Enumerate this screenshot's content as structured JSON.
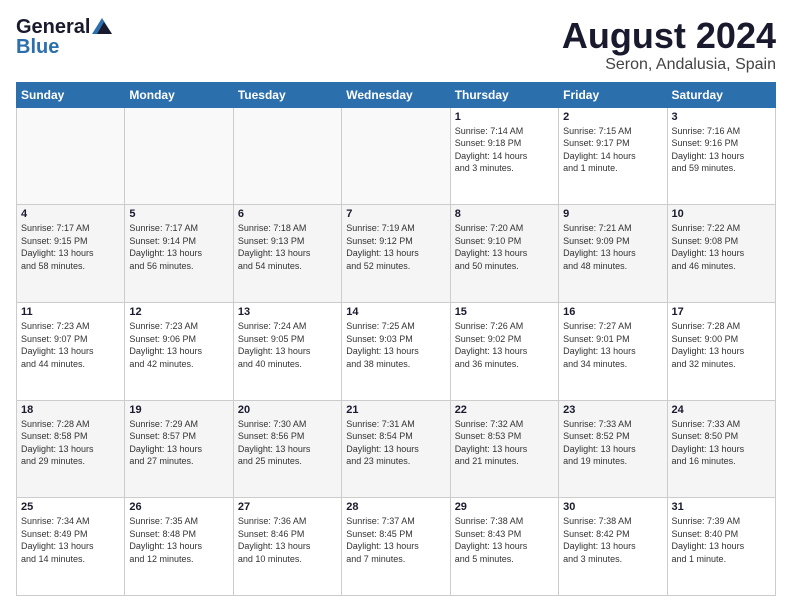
{
  "header": {
    "logo_general": "General",
    "logo_blue": "Blue",
    "title": "August 2024",
    "subtitle": "Seron, Andalusia, Spain"
  },
  "days_of_week": [
    "Sunday",
    "Monday",
    "Tuesday",
    "Wednesday",
    "Thursday",
    "Friday",
    "Saturday"
  ],
  "weeks": [
    [
      {
        "day": "",
        "info": "",
        "empty": true
      },
      {
        "day": "",
        "info": "",
        "empty": true
      },
      {
        "day": "",
        "info": "",
        "empty": true
      },
      {
        "day": "",
        "info": "",
        "empty": true
      },
      {
        "day": "1",
        "info": "Sunrise: 7:14 AM\nSunset: 9:18 PM\nDaylight: 14 hours\nand 3 minutes.",
        "empty": false
      },
      {
        "day": "2",
        "info": "Sunrise: 7:15 AM\nSunset: 9:17 PM\nDaylight: 14 hours\nand 1 minute.",
        "empty": false
      },
      {
        "day": "3",
        "info": "Sunrise: 7:16 AM\nSunset: 9:16 PM\nDaylight: 13 hours\nand 59 minutes.",
        "empty": false
      }
    ],
    [
      {
        "day": "4",
        "info": "Sunrise: 7:17 AM\nSunset: 9:15 PM\nDaylight: 13 hours\nand 58 minutes.",
        "empty": false
      },
      {
        "day": "5",
        "info": "Sunrise: 7:17 AM\nSunset: 9:14 PM\nDaylight: 13 hours\nand 56 minutes.",
        "empty": false
      },
      {
        "day": "6",
        "info": "Sunrise: 7:18 AM\nSunset: 9:13 PM\nDaylight: 13 hours\nand 54 minutes.",
        "empty": false
      },
      {
        "day": "7",
        "info": "Sunrise: 7:19 AM\nSunset: 9:12 PM\nDaylight: 13 hours\nand 52 minutes.",
        "empty": false
      },
      {
        "day": "8",
        "info": "Sunrise: 7:20 AM\nSunset: 9:10 PM\nDaylight: 13 hours\nand 50 minutes.",
        "empty": false
      },
      {
        "day": "9",
        "info": "Sunrise: 7:21 AM\nSunset: 9:09 PM\nDaylight: 13 hours\nand 48 minutes.",
        "empty": false
      },
      {
        "day": "10",
        "info": "Sunrise: 7:22 AM\nSunset: 9:08 PM\nDaylight: 13 hours\nand 46 minutes.",
        "empty": false
      }
    ],
    [
      {
        "day": "11",
        "info": "Sunrise: 7:23 AM\nSunset: 9:07 PM\nDaylight: 13 hours\nand 44 minutes.",
        "empty": false
      },
      {
        "day": "12",
        "info": "Sunrise: 7:23 AM\nSunset: 9:06 PM\nDaylight: 13 hours\nand 42 minutes.",
        "empty": false
      },
      {
        "day": "13",
        "info": "Sunrise: 7:24 AM\nSunset: 9:05 PM\nDaylight: 13 hours\nand 40 minutes.",
        "empty": false
      },
      {
        "day": "14",
        "info": "Sunrise: 7:25 AM\nSunset: 9:03 PM\nDaylight: 13 hours\nand 38 minutes.",
        "empty": false
      },
      {
        "day": "15",
        "info": "Sunrise: 7:26 AM\nSunset: 9:02 PM\nDaylight: 13 hours\nand 36 minutes.",
        "empty": false
      },
      {
        "day": "16",
        "info": "Sunrise: 7:27 AM\nSunset: 9:01 PM\nDaylight: 13 hours\nand 34 minutes.",
        "empty": false
      },
      {
        "day": "17",
        "info": "Sunrise: 7:28 AM\nSunset: 9:00 PM\nDaylight: 13 hours\nand 32 minutes.",
        "empty": false
      }
    ],
    [
      {
        "day": "18",
        "info": "Sunrise: 7:28 AM\nSunset: 8:58 PM\nDaylight: 13 hours\nand 29 minutes.",
        "empty": false
      },
      {
        "day": "19",
        "info": "Sunrise: 7:29 AM\nSunset: 8:57 PM\nDaylight: 13 hours\nand 27 minutes.",
        "empty": false
      },
      {
        "day": "20",
        "info": "Sunrise: 7:30 AM\nSunset: 8:56 PM\nDaylight: 13 hours\nand 25 minutes.",
        "empty": false
      },
      {
        "day": "21",
        "info": "Sunrise: 7:31 AM\nSunset: 8:54 PM\nDaylight: 13 hours\nand 23 minutes.",
        "empty": false
      },
      {
        "day": "22",
        "info": "Sunrise: 7:32 AM\nSunset: 8:53 PM\nDaylight: 13 hours\nand 21 minutes.",
        "empty": false
      },
      {
        "day": "23",
        "info": "Sunrise: 7:33 AM\nSunset: 8:52 PM\nDaylight: 13 hours\nand 19 minutes.",
        "empty": false
      },
      {
        "day": "24",
        "info": "Sunrise: 7:33 AM\nSunset: 8:50 PM\nDaylight: 13 hours\nand 16 minutes.",
        "empty": false
      }
    ],
    [
      {
        "day": "25",
        "info": "Sunrise: 7:34 AM\nSunset: 8:49 PM\nDaylight: 13 hours\nand 14 minutes.",
        "empty": false
      },
      {
        "day": "26",
        "info": "Sunrise: 7:35 AM\nSunset: 8:48 PM\nDaylight: 13 hours\nand 12 minutes.",
        "empty": false
      },
      {
        "day": "27",
        "info": "Sunrise: 7:36 AM\nSunset: 8:46 PM\nDaylight: 13 hours\nand 10 minutes.",
        "empty": false
      },
      {
        "day": "28",
        "info": "Sunrise: 7:37 AM\nSunset: 8:45 PM\nDaylight: 13 hours\nand 7 minutes.",
        "empty": false
      },
      {
        "day": "29",
        "info": "Sunrise: 7:38 AM\nSunset: 8:43 PM\nDaylight: 13 hours\nand 5 minutes.",
        "empty": false
      },
      {
        "day": "30",
        "info": "Sunrise: 7:38 AM\nSunset: 8:42 PM\nDaylight: 13 hours\nand 3 minutes.",
        "empty": false
      },
      {
        "day": "31",
        "info": "Sunrise: 7:39 AM\nSunset: 8:40 PM\nDaylight: 13 hours\nand 1 minute.",
        "empty": false
      }
    ]
  ]
}
